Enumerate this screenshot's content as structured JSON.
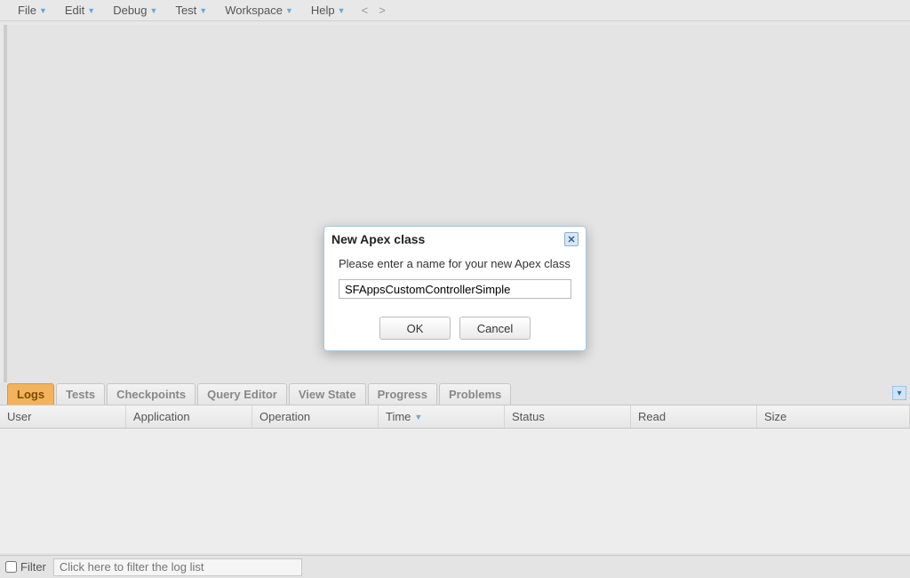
{
  "menubar": {
    "items": [
      {
        "label": "File"
      },
      {
        "label": "Edit"
      },
      {
        "label": "Debug"
      },
      {
        "label": "Test"
      },
      {
        "label": "Workspace"
      },
      {
        "label": "Help"
      }
    ],
    "nav_back": "<",
    "nav_forward": ">"
  },
  "bottom": {
    "tabs": [
      {
        "label": "Logs",
        "active": true
      },
      {
        "label": "Tests"
      },
      {
        "label": "Checkpoints"
      },
      {
        "label": "Query Editor"
      },
      {
        "label": "View State"
      },
      {
        "label": "Progress"
      },
      {
        "label": "Problems"
      }
    ],
    "columns": [
      {
        "label": "User",
        "width": 142
      },
      {
        "label": "Application",
        "width": 142
      },
      {
        "label": "Operation",
        "width": 142
      },
      {
        "label": "Time",
        "width": 142,
        "sorted": "desc"
      },
      {
        "label": "Status",
        "width": 142
      },
      {
        "label": "Read",
        "width": 142
      },
      {
        "label": "Size",
        "width": 142
      }
    ],
    "filter_label": "Filter",
    "filter_placeholder": "Click here to filter the log list"
  },
  "dialog": {
    "title": "New Apex class",
    "prompt": "Please enter a name for your new Apex class",
    "value": "SFAppsCustomControllerSimple",
    "ok_label": "OK",
    "cancel_label": "Cancel"
  }
}
